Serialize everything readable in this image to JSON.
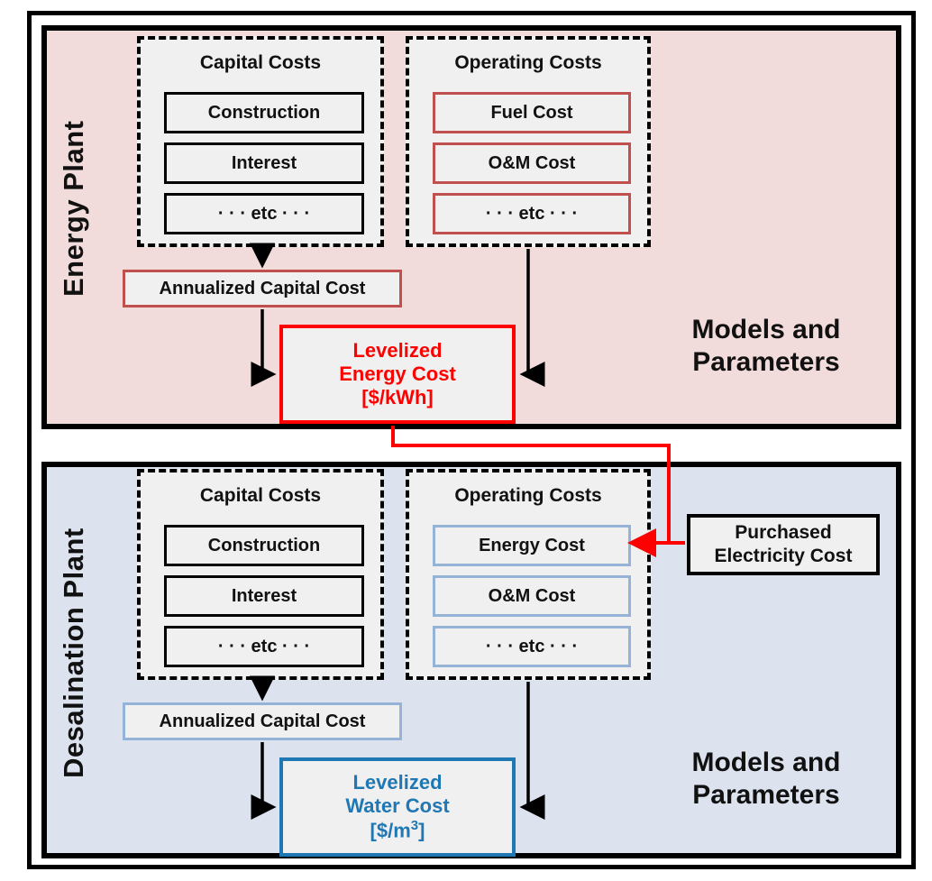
{
  "diagram": {
    "title": "Levelized cost model structure for coupled energy and desalination plants",
    "colors": {
      "energy_panel_bg": "#f2dcdb",
      "desal_panel_bg": "#dce3ee",
      "energy_accent": "#c0504d",
      "desal_accent": "#95b3d7",
      "levelized_energy": "#ff0000",
      "levelized_water": "#1f78b4",
      "frame": "#000000",
      "box_bg": "#f0f0f0"
    }
  },
  "energy_plant": {
    "label": "Energy Plant",
    "models_and_parameters": "Models and\nParameters",
    "capital_costs": {
      "title": "Capital Costs",
      "items": [
        {
          "label": "Construction"
        },
        {
          "label": "Interest"
        },
        {
          "label": "· · · etc · · ·"
        }
      ]
    },
    "operating_costs": {
      "title": "Operating Costs",
      "items": [
        {
          "label": "Fuel Cost"
        },
        {
          "label": "O&M Cost"
        },
        {
          "label": "· · · etc · · ·"
        }
      ]
    },
    "annualized_capital_cost": "Annualized Capital Cost",
    "levelized": {
      "line1": "Levelized",
      "line2": "Energy Cost",
      "unit": "[$/kWh]"
    }
  },
  "desalination_plant": {
    "label": "Desalination Plant",
    "models_and_parameters": "Models and\nParameters",
    "capital_costs": {
      "title": "Capital Costs",
      "items": [
        {
          "label": "Construction"
        },
        {
          "label": "Interest"
        },
        {
          "label": "· · · etc · · ·"
        }
      ]
    },
    "operating_costs": {
      "title": "Operating Costs",
      "items": [
        {
          "label": "Energy Cost"
        },
        {
          "label": "O&M Cost"
        },
        {
          "label": "· · · etc · · ·"
        }
      ]
    },
    "annualized_capital_cost": "Annualized Capital Cost",
    "levelized": {
      "line1": "Levelized",
      "line2": "Water Cost",
      "unit_prefix": "[$/m",
      "unit_sup": "3",
      "unit_suffix": "]"
    }
  },
  "external": {
    "purchased_electricity": {
      "line1": "Purchased",
      "line2": "Electricity Cost"
    }
  }
}
